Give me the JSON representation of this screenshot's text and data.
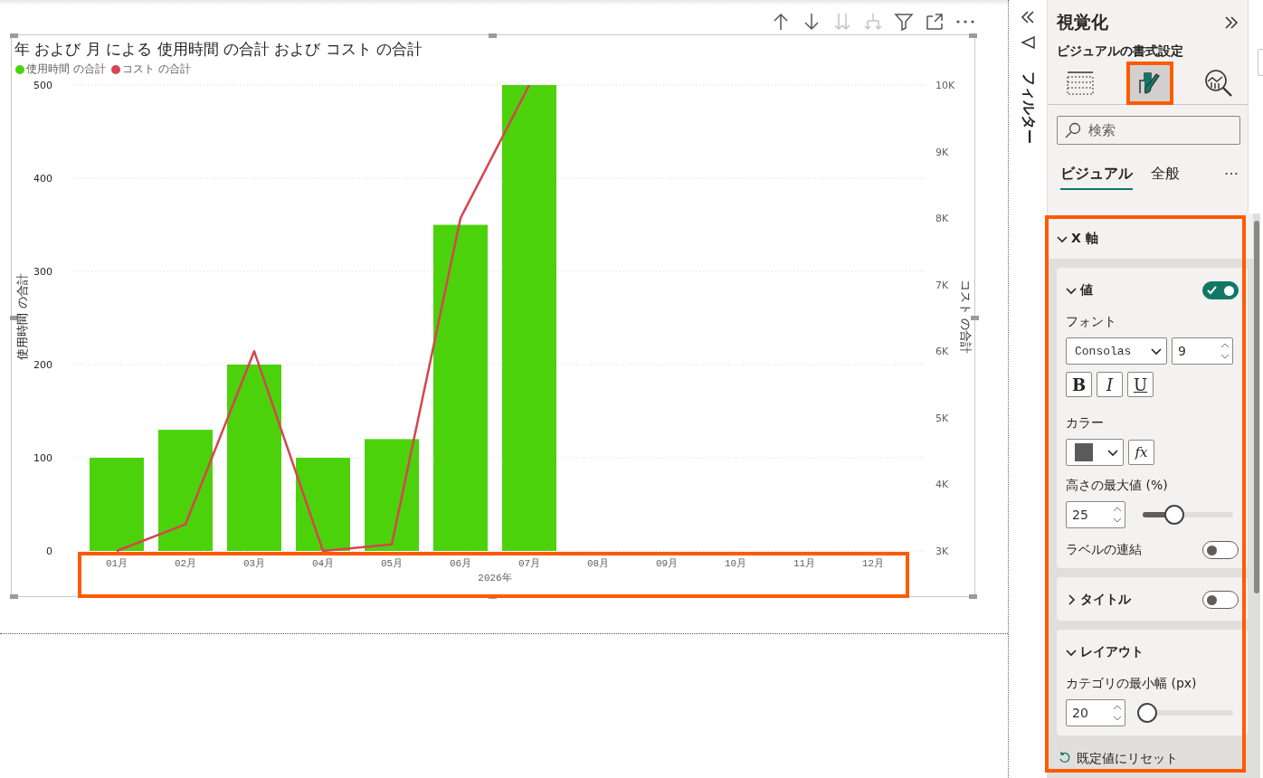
{
  "visual_toolbar": [
    {
      "kind": "arrow-up",
      "disabled": false
    },
    {
      "kind": "arrow-down",
      "disabled": false
    },
    {
      "kind": "double-down",
      "disabled": true
    },
    {
      "kind": "expand-down",
      "disabled": true
    },
    {
      "kind": "filter",
      "disabled": false
    },
    {
      "kind": "focus",
      "disabled": false
    },
    {
      "kind": "more",
      "disabled": false
    }
  ],
  "visual": {
    "title": "年 および 月 による 使用時間 の合計 および コスト の合計",
    "bars": {
      "chart_data": {
        "type": "bar",
        "xlabel": "2026年",
        "ylabel": "使用時間 の合計",
        "categories": [
          "01月",
          "02月",
          "03月",
          "04月",
          "05月",
          "06月",
          "07月",
          "08月",
          "09月",
          "10月",
          "11月",
          "12月"
        ],
        "series": [
          {
            "name": "使用時間 の合計",
            "color": "#4bd20b",
            "values": [
              100,
              130,
              200,
              100,
              120,
              350,
              500,
              null,
              null,
              null,
              null,
              null
            ]
          }
        ],
        "ylim": [
          0,
          500
        ],
        "yticks": [
          0,
          100,
          200,
          300,
          400,
          500
        ],
        "grid": true
      }
    },
    "cost_line": {
      "chart_data": {
        "type": "line",
        "ylabel": "コスト の合計",
        "series": [
          {
            "name": "コスト の合計",
            "color": "#d64550",
            "values": [
              3000,
              3400,
              6000,
              3000,
              3100,
              8000,
              10000,
              null,
              null,
              null,
              null,
              null
            ]
          }
        ],
        "ylim": [
          3000,
          10000
        ],
        "yticks": [
          {
            "value": 3000,
            "label": "3K"
          },
          {
            "value": 4000,
            "label": "4K"
          },
          {
            "value": 5000,
            "label": "5K"
          },
          {
            "value": 6000,
            "label": "6K"
          },
          {
            "value": 7000,
            "label": "7K"
          },
          {
            "value": 8000,
            "label": "8K"
          },
          {
            "value": 9000,
            "label": "9K"
          },
          {
            "value": 10000,
            "label": "10K"
          }
        ]
      }
    }
  },
  "filter_pane": {
    "label": "フィルター"
  },
  "pane": {
    "title": "視覚化",
    "subtitle": "ビジュアルの書式設定",
    "view_buttons": [
      {
        "kind": "fields",
        "selected": false
      },
      {
        "kind": "format",
        "selected": true
      },
      {
        "kind": "analytics",
        "selected": false
      }
    ],
    "search": {
      "placeholder": "検索"
    },
    "tabs": [
      {
        "label": "ビジュアル",
        "selected": true
      },
      {
        "label": "全般",
        "selected": false
      }
    ],
    "more_label": "⋯",
    "section": {
      "label": "X 軸",
      "expanded": true,
      "cards": [
        {
          "label": "値",
          "expanded": true,
          "on": true,
          "controls": [
            {
              "kind": "font",
              "label": "フォント",
              "font": "Consolas",
              "size": "9",
              "styles": [
                "B",
                "I",
                "U"
              ]
            },
            {
              "kind": "color",
              "label": "カラー",
              "color": "#5a5a5a",
              "fx": "fx"
            },
            {
              "kind": "slider",
              "label": "高さの最大値 (%)",
              "value": "25",
              "level": 0.3
            },
            {
              "kind": "toggle",
              "label": "ラベルの連結",
              "on": false
            }
          ]
        },
        {
          "label": "タイトル",
          "expanded": false,
          "on": false
        },
        {
          "label": "レイアウト",
          "expanded": true,
          "controls": [
            {
              "kind": "slider",
              "label": "カテゴリの最小幅 (px)",
              "value": "20",
              "level": 0
            }
          ]
        }
      ]
    },
    "reset_label": "既定値にリセット"
  }
}
